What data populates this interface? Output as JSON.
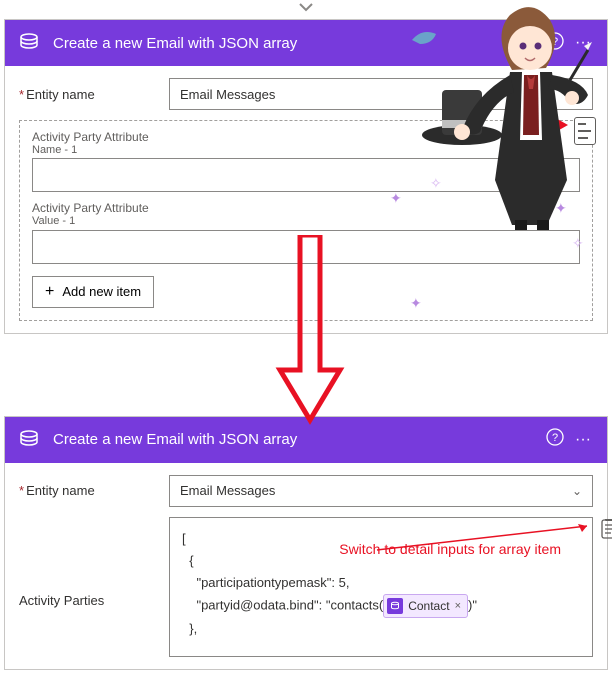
{
  "card1": {
    "title": "Create a new Email with JSON array",
    "entity_label": "Entity name",
    "entity_value": "Email Messages",
    "attr_name_label_l1": "Activity Party Attribute",
    "attr_name_label_l2": "Name - 1",
    "attr_value_label_l1": "Activity Party Attribute",
    "attr_value_label_l2": "Value - 1",
    "add_item_label": "Add new item"
  },
  "card2": {
    "title": "Create a new Email with JSON array",
    "entity_label": "Entity name",
    "entity_value": "Email Messages",
    "parties_label": "Activity Parties",
    "code_line1": "[",
    "code_line2": "{",
    "code_line3a": "\"participationtypemask\": 5,",
    "code_line4a": "\"partyid@odata.bind\": \"contacts(",
    "code_line4b": ")\"",
    "code_line5": "},",
    "token_label": "Contact",
    "token_x": "×"
  },
  "annotations": {
    "switch_text": "Switch to detail inputs for array item"
  },
  "glyphs": {
    "help": "?",
    "more": "···",
    "plus": "+",
    "chev_down": "⌄"
  }
}
